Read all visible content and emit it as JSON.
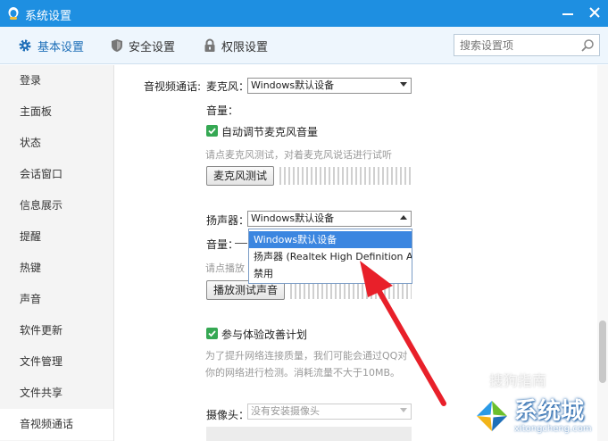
{
  "window": {
    "title": "系统设置"
  },
  "tabs": [
    {
      "label": "基本设置",
      "icon": "gear-icon",
      "active": true
    },
    {
      "label": "安全设置",
      "icon": "shield-icon",
      "active": false
    },
    {
      "label": "权限设置",
      "icon": "lock-icon",
      "active": false
    }
  ],
  "search": {
    "placeholder": "搜索设置项"
  },
  "sidebar": {
    "items": [
      {
        "label": "登录"
      },
      {
        "label": "主面板"
      },
      {
        "label": "状态"
      },
      {
        "label": "会话窗口"
      },
      {
        "label": "信息展示"
      },
      {
        "label": "提醒"
      },
      {
        "label": "热键"
      },
      {
        "label": "声音"
      },
      {
        "label": "软件更新"
      },
      {
        "label": "文件管理"
      },
      {
        "label": "文件共享"
      },
      {
        "label": "音视频通话",
        "active": true
      }
    ]
  },
  "av": {
    "section_label": "音视频通话:",
    "mic_label": "麦克风：",
    "mic_value": "Windows默认设备",
    "mic_volume_label": "音量：",
    "auto_adjust_label": "自动调节麦克风音量",
    "auto_adjust_checked": true,
    "mic_hint": "请点麦克风测试，对着麦克风说话进行试听",
    "mic_test_button": "麦克风测试",
    "speaker_label": "扬声器：",
    "speaker_value": "Windows默认设备",
    "speaker_options": [
      "Windows默认设备",
      "扬声器 (Realtek High Definition Audio",
      "禁用"
    ],
    "speaker_selected_index": 0,
    "speaker_volume_label": "音量：",
    "speaker_hint_partial": "请点播放",
    "play_test_button": "播放测试声音",
    "experience_label": "参与体验改善计划",
    "experience_checked": true,
    "experience_desc_1": "为了提升网络连接质量，我们可能会通过QQ对",
    "experience_desc_2": "你的网络进行检测。消耗流量不大于10MB。",
    "camera_label": "摄像头：",
    "camera_value": "没有安装摄像头"
  },
  "watermark": {
    "brand": "系统城",
    "domain": "xitongcheng.com",
    "sogou_text": "搜狗指南"
  },
  "colors": {
    "titlebar": "#1e8fe1",
    "accent": "#1e6fb8",
    "checkbox": "#35a853",
    "dropdown_selected": "#3b86e0",
    "annotation_arrow": "#e8202a"
  }
}
